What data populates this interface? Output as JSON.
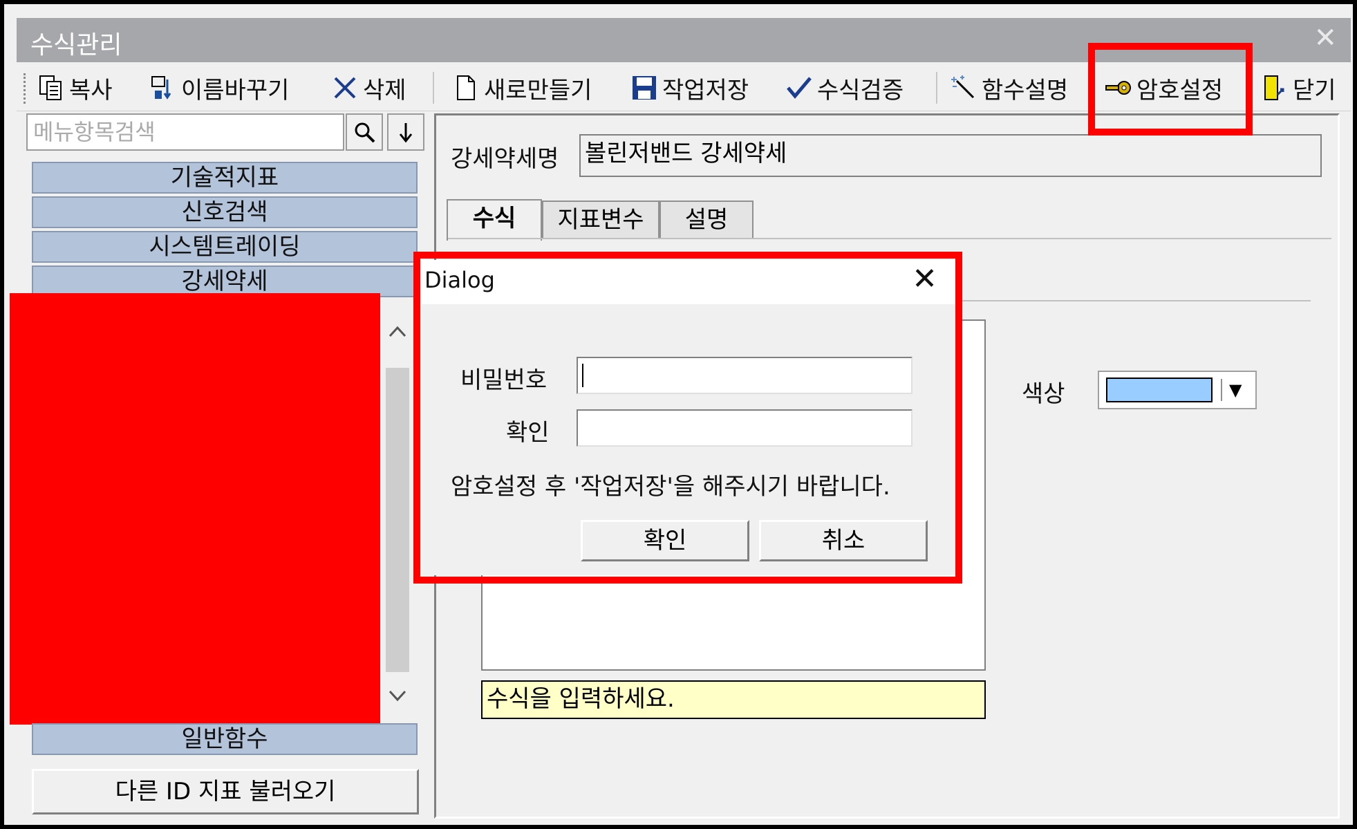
{
  "window": {
    "title": "수식관리",
    "close_glyph": "✕"
  },
  "toolbar": [
    {
      "label": "복사",
      "icon": "copy-icon"
    },
    {
      "label": "이름바꾸기",
      "icon": "rename-icon"
    },
    {
      "label": "삭제",
      "icon": "delete-icon"
    },
    {
      "label": "새로만들기",
      "icon": "new-document-icon"
    },
    {
      "label": "작업저장",
      "icon": "save-icon"
    },
    {
      "label": "수식검증",
      "icon": "check-icon"
    },
    {
      "label": "함수설명",
      "icon": "magic-wand-icon"
    },
    {
      "label": "암호설정",
      "icon": "key-icon"
    },
    {
      "label": "닫기",
      "icon": "exit-door-icon"
    }
  ],
  "sidebar": {
    "search_placeholder": "메뉴항목검색",
    "categories": [
      "기술적지표",
      "신호검색",
      "시스템트레이딩",
      "강세약세",
      "일반함수"
    ],
    "load_button": "다른 ID 지표 불러오기"
  },
  "main": {
    "name_label": "강세약세명",
    "name_value": "볼린저밴드 강세약세",
    "tabs": [
      "수식",
      "지표변수",
      "설명"
    ],
    "active_tab": "수식",
    "color_label": "색상",
    "color_value": "#99ccff",
    "hint": "수식을 입력하세요."
  },
  "dialog": {
    "title": "Dialog",
    "password_label": "비밀번호",
    "confirm_label": "확인",
    "message": "암호설정 후 '작업저장'을 해주시기 바랍니다.",
    "ok_button": "확인",
    "cancel_button": "취소"
  },
  "colors": {
    "highlight": "#ff0000",
    "category_bg": "#b3c3d9",
    "hint_bg": "#ffffc8"
  }
}
